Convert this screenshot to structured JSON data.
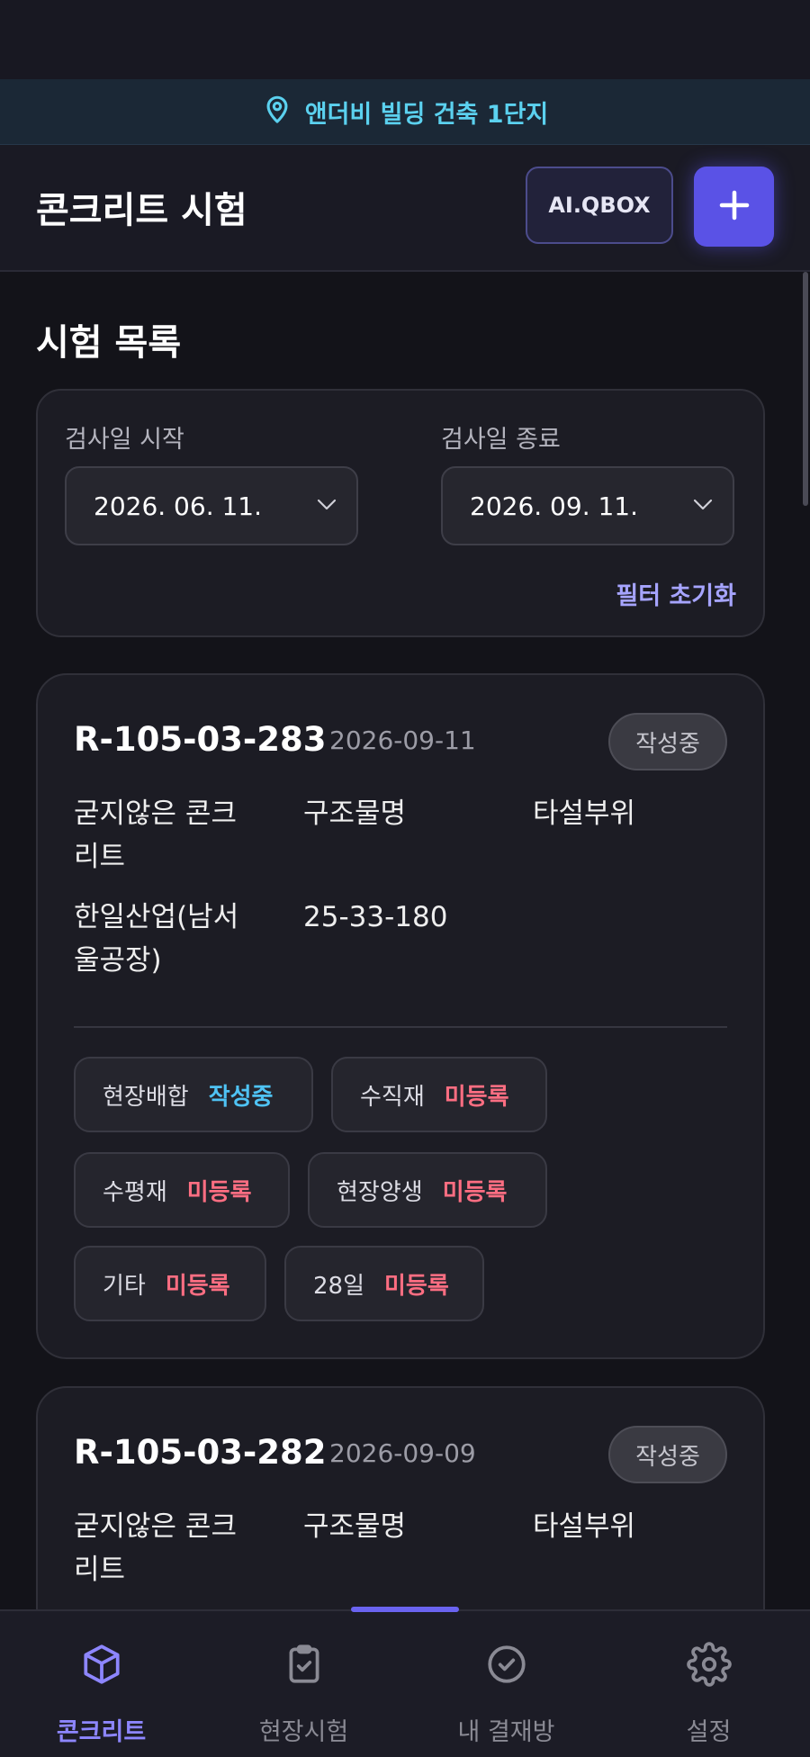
{
  "location_banner": {
    "text": "앤더비 빌딩 건축 1단지",
    "icon": "location-pin-icon"
  },
  "header": {
    "title": "콘크리트 시험",
    "qbox_label": "AI.QBOX",
    "add_icon": "plus-icon"
  },
  "list": {
    "title": "시험 목록",
    "filter": {
      "start_label": "검사일 시작",
      "start_value": "2026. 06. 11.",
      "end_label": "검사일 종료",
      "end_value": "2026. 09. 11.",
      "reset_label": "필터 초기화"
    },
    "cards": [
      {
        "id": "R-105-03-283",
        "date": "2026-09-11",
        "status": "작성중",
        "cells": [
          "굳지않은 콘크리트",
          "구조물명",
          "타설부위",
          "한일산업(남서울공장)",
          "25-33-180"
        ],
        "chips": [
          {
            "label": "현장배합",
            "status": "작성중"
          },
          {
            "label": "수직재",
            "status": "미등록"
          },
          {
            "label": "수평재",
            "status": "미등록"
          },
          {
            "label": "현장양생",
            "status": "미등록"
          },
          {
            "label": "기타",
            "status": "미등록"
          },
          {
            "label": "28일",
            "status": "미등록"
          }
        ]
      },
      {
        "id": "R-105-03-282",
        "date": "2026-09-09",
        "status": "작성중",
        "cells": [
          "굳지않은 콘크리트",
          "구조물명",
          "타설부위"
        ]
      }
    ]
  },
  "nav": {
    "items": [
      {
        "label": "콘크리트",
        "icon": "cube-icon",
        "active": true
      },
      {
        "label": "현장시험",
        "icon": "clipboard-check-icon",
        "active": false
      },
      {
        "label": "내 결재방",
        "icon": "check-circle-icon",
        "active": false
      },
      {
        "label": "설정",
        "icon": "gear-icon",
        "active": false
      }
    ]
  },
  "colors": {
    "accent": "#5a52e6",
    "active_nav": "#8d86ff",
    "inactive_nav": "#8a8a94",
    "status_in_progress": "#4fc3f4",
    "status_unregistered": "#ff6e82"
  }
}
